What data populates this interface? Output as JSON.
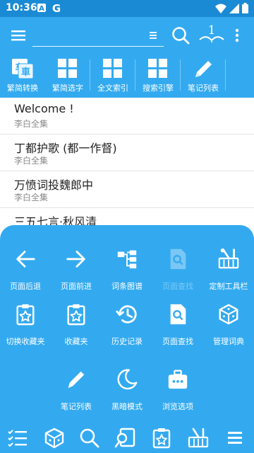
{
  "status_bar": {
    "time": "10:36",
    "icons_left": [
      "a-icon",
      "google-g-icon"
    ],
    "icons_right": [
      "wifi-icon",
      "signal-icon",
      "battery-icon"
    ]
  },
  "app_bar": {
    "search_value": "",
    "icons": [
      "menu-icon",
      "clear-icon",
      "search-icon",
      "dictionary-icon",
      "more-vert-icon"
    ]
  },
  "toolbar": {
    "items": [
      {
        "label": "繁简转换",
        "icon": "traditional-simplified-icon"
      },
      {
        "label": "繁简选字",
        "icon": "grid-icon"
      },
      {
        "label": "全文索引",
        "icon": "grid-icon"
      },
      {
        "label": "搜索引擎",
        "icon": "grid-icon"
      },
      {
        "label": "笔记列表",
        "icon": "pencil-icon"
      }
    ]
  },
  "list": {
    "items": [
      {
        "title": "Welcome !",
        "subtitle": "李白全集"
      },
      {
        "title": "丁都护歌 (都一作督)",
        "subtitle": "李白全集"
      },
      {
        "title": "万愤词投魏郎中",
        "subtitle": "李白全集"
      },
      {
        "title": "三五七言·秋风清",
        "subtitle": ""
      }
    ]
  },
  "sheet": {
    "items": [
      {
        "label": "页面后退",
        "icon": "arrow-left-icon",
        "enabled": true
      },
      {
        "label": "页面前进",
        "icon": "arrow-right-icon",
        "enabled": true
      },
      {
        "label": "词条图谱",
        "icon": "tree-icon",
        "enabled": true
      },
      {
        "label": "页面查找",
        "icon": "page-search-icon",
        "enabled": false
      },
      {
        "label": "定制工具栏",
        "icon": "toolbox-icon",
        "enabled": true
      },
      {
        "label": "切换收藏夹",
        "icon": "clipboard-star-icon",
        "enabled": true
      },
      {
        "label": "收藏夹",
        "icon": "clipboard-star-icon",
        "enabled": true
      },
      {
        "label": "历史记录",
        "icon": "history-icon",
        "enabled": true
      },
      {
        "label": "页面查找",
        "icon": "page-search-icon",
        "enabled": true
      },
      {
        "label": "管理词典",
        "icon": "cube-icon",
        "enabled": true
      },
      {
        "label": "笔记列表",
        "icon": "pencil-icon",
        "enabled": true
      },
      {
        "label": "黑暗模式",
        "icon": "moon-icon",
        "enabled": true
      },
      {
        "label": "浏览选项",
        "icon": "briefcase-icon",
        "enabled": true
      }
    ]
  },
  "bottom_nav": {
    "items": [
      "list-icon",
      "cube-icon",
      "search-icon",
      "search-doc-icon",
      "clipboard-star-icon",
      "toolbox-icon",
      "menu-lines-icon"
    ]
  },
  "colors": {
    "status_bar": "#1a8ad4",
    "app_bar": "#33aaf0",
    "text": "#222222",
    "subtext": "#8a8a8a"
  }
}
